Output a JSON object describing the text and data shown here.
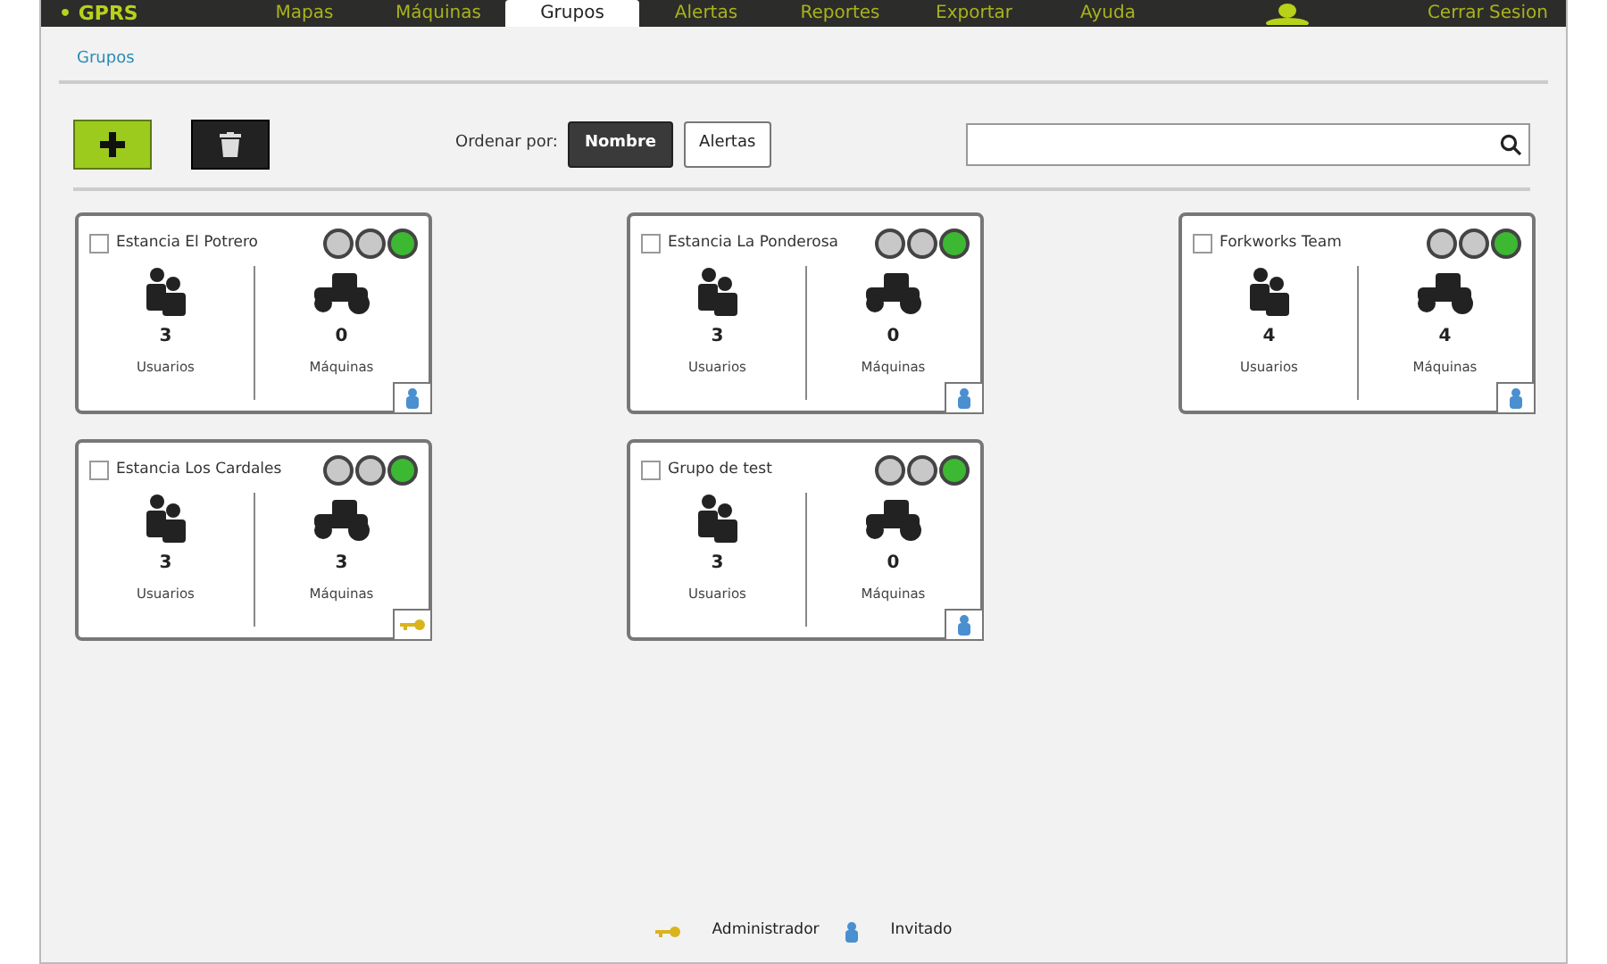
{
  "nav": {
    "logo": "• GPRS",
    "items": [
      {
        "label": "Mapas",
        "selected": false
      },
      {
        "label": "Máquinas",
        "selected": false
      },
      {
        "label": "Grupos",
        "selected": true
      },
      {
        "label": "Alertas",
        "selected": false
      },
      {
        "label": "Reportes",
        "selected": false
      },
      {
        "label": "Exportar",
        "selected": false
      },
      {
        "label": "Ayuda",
        "selected": false
      }
    ],
    "logout": "Cerrar Sesion"
  },
  "breadcrumb": "Grupos",
  "toolbar": {
    "sort_label": "Ordenar por:",
    "sort_options": [
      {
        "label": "Nombre",
        "selected": true
      },
      {
        "label": "Alertas",
        "selected": false
      }
    ]
  },
  "groups": [
    {
      "name": "Estancia El Potrero",
      "checked": false,
      "lights": [
        {
          "color": "#c8c8c8"
        },
        {
          "color": "#c8c8c8"
        },
        {
          "color": "#3cb832"
        }
      ],
      "users": "3",
      "users_label": "Usuarios",
      "machines": "0",
      "machines_label": "Máquinas",
      "kind": "guest"
    },
    {
      "name": "Estancia La Ponderosa",
      "checked": false,
      "lights": [
        {
          "color": "#c8c8c8"
        },
        {
          "color": "#c8c8c8"
        },
        {
          "color": "#3cb832"
        }
      ],
      "users": "3",
      "users_label": "Usuarios",
      "machines": "0",
      "machines_label": "Máquinas",
      "kind": "guest"
    },
    {
      "name": "Forkworks Team",
      "checked": false,
      "lights": [
        {
          "color": "#c8c8c8"
        },
        {
          "color": "#c8c8c8"
        },
        {
          "color": "#3cb832"
        }
      ],
      "users": "4",
      "users_label": "Usuarios",
      "machines": "4",
      "machines_label": "Máquinas",
      "kind": "guest"
    },
    {
      "name": "Estancia Los Cardales",
      "checked": false,
      "lights": [
        {
          "color": "#c8c8c8"
        },
        {
          "color": "#c8c8c8"
        },
        {
          "color": "#3cb832"
        }
      ],
      "users": "3",
      "users_label": "Usuarios",
      "machines": "3",
      "machines_label": "Máquinas",
      "kind": "admin"
    },
    {
      "name": "Grupo de test",
      "checked": false,
      "lights": [
        {
          "color": "#c8c8c8"
        },
        {
          "color": "#c8c8c8"
        },
        {
          "color": "#3cb832"
        }
      ],
      "users": "3",
      "users_label": "Usuarios",
      "machines": "0",
      "machines_label": "Máquinas",
      "kind": "guest"
    }
  ],
  "legend": [
    {
      "kind": "admin",
      "label": "Administrador"
    },
    {
      "kind": "guest",
      "label": "Invitado"
    }
  ]
}
